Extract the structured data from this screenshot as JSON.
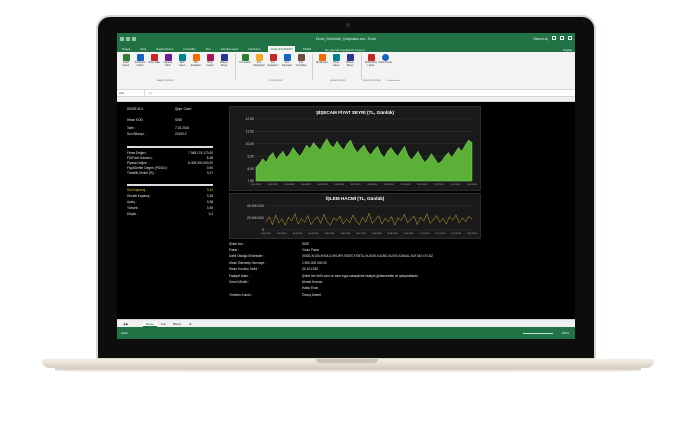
{
  "excel": {
    "title": "Ekran_Görüntüsü_Çalışmaları.xlsx - Excel",
    "user": "Oturum aç",
    "share": "Paylaş",
    "tabs": [
      "Dosya",
      "Giriş",
      "Sayfa Düzeni",
      "Formüller",
      "Veri",
      "Gözden Geçir",
      "Görünüm",
      "ANALİZ EXPERT",
      "TEAM"
    ],
    "active_tab": "ANALİZ EXPERT",
    "tell_me": "Ne yapmak istediğinizi söyleyin",
    "ribbon_buttons": [
      "Analiz Expert",
      "Portföyüm Analizi",
      "Hisse Tablo",
      "Kapanış Tablo",
      "Tarih Listesi",
      "Bul Endeksler",
      "Öztel Listeler",
      "Bilanço Rasyo",
      "Fon Listesi",
      "Fon Kategorileri",
      "Fon Endeksleri",
      "Fon Karşılaştır",
      "Fon Yöneticileri",
      "Bul Endeks",
      "Hisse Listesi",
      "Bilanço Rasyo",
      "Dahili Bizim Linkler",
      "Yardımcımda"
    ],
    "ribbon_groups": [
      "ANALİZ EXPERT",
      "FON EXPERT",
      "HİSSE EXPERT",
      "TAVSİYE EXPERT",
      "Yardımcımda"
    ],
    "name_box": "H16",
    "sheet_tabs": [
      "Hisse",
      "Fon",
      "Bilanç"
    ],
    "active_sheet": "Hisse",
    "status": "Hazır",
    "zoom": "100%"
  },
  "stock": {
    "header_label": "HİSSE ADI:",
    "header_value": "Şişe Cam",
    "fields": [
      {
        "label": "Hisse KOD :",
        "value": "SISE"
      },
      {
        "label": "Tarih :",
        "value": "7.03.2016"
      },
      {
        "label": "Son Bilanço :",
        "value": "2015/12"
      }
    ],
    "metrics": [
      {
        "label": "Firma Değeri :",
        "value": "7.965.176.170,00"
      },
      {
        "label": "FD/Favö Kazancı :",
        "value": "8,38"
      },
      {
        "label": "Piyasa Değeri :",
        "value": "6.408.000.000,00"
      },
      {
        "label": "Fiyat/Defter Değeri (PD/DD) :",
        "value": "0,90"
      },
      {
        "label": "Tümelik Verimi (%) :",
        "value": "3,27"
      }
    ],
    "prices": [
      {
        "label": "Son Kapanış :",
        "value": "3,42"
      },
      {
        "label": "Önceki Kapanış :",
        "value": "3,38"
      },
      {
        "label": "Açılış :",
        "value": "3,38"
      },
      {
        "label": "Yüksek :",
        "value": "3,45"
      },
      {
        "label": "Düşük :",
        "value": "3,4"
      }
    ]
  },
  "info": {
    "rows": [
      {
        "label": "Şirket Adı :",
        "value": "SISE"
      },
      {
        "label": "Pazar :",
        "value": "Yıldız Pazar"
      },
      {
        "label": "Dahil Olduğu Endeksler :",
        "value": "XI030,XI100,XHOLD,XKURY,XSIST,XTMTU,XUO30,XUO50,XU100,XUMAL,XUTUM,XYLDZ"
      },
      {
        "label": "Hisse Ödenmiş Sermaye :",
        "value": "1.900.000.000,00"
      },
      {
        "label": "Hisse Kuruluş Tarihi :",
        "value": "24.10.1935"
      },
      {
        "label": "Faaliyet Alanı :",
        "value": "Şirket her türlü cam ve cam eşya sanayiinde faaliyet göstermekte ve çalışmaktadır."
      },
      {
        "label": "Genel Müdür :",
        "value": "Ahmet Kırman"
      },
      {
        "label": "",
        "value": "Hakkı Ersin"
      },
      {
        "label": "Yönetim Kurulu :",
        "value": "Özsoy Ahmet"
      }
    ]
  },
  "chart_data": [
    {
      "type": "area",
      "title": "ŞİŞECAM FİYAT SEYRİ (TL, Günlük)",
      "ylim": [
        7.5,
        12.5
      ],
      "yticks": [
        "12,50",
        "11,50",
        "10,50",
        "9,50",
        "8,50",
        "7,50"
      ],
      "xticks": [
        "9.01.2015",
        "9.02.2015",
        "9.03.2015",
        "9.04.2015",
        "9.05.2015",
        "9.06.2015",
        "9.07.2015",
        "9.08.2015",
        "9.09.2015",
        "9.10.2015",
        "9.11.2015",
        "9.12.2015",
        "9.01.2016",
        "9.02.2016"
      ],
      "color": "#5fb83a",
      "values": [
        8.6,
        8.9,
        9.3,
        9.0,
        9.5,
        9.8,
        9.2,
        9.6,
        9.9,
        9.4,
        9.7,
        10.2,
        9.8,
        9.5,
        9.9,
        10.4,
        10.1,
        10.6,
        10.3,
        10.0,
        10.5,
        10.9,
        10.4,
        10.2,
        10.7,
        10.3,
        10.0,
        10.5,
        10.8,
        10.2,
        9.8,
        10.1,
        10.4,
        9.9,
        9.6,
        10.0,
        10.3,
        9.7,
        9.4,
        9.9,
        10.2,
        9.8,
        9.5,
        9.9,
        10.3,
        9.6,
        9.2,
        9.5,
        9.9,
        9.4,
        9.0,
        9.3,
        9.7,
        9.3,
        8.9,
        9.1,
        9.5,
        9.8,
        9.4,
        9.8,
        10.2,
        9.9,
        10.4,
        10.8,
        10.6
      ]
    },
    {
      "type": "line",
      "title": "İŞLEM HACMİ (TL, Günlük)",
      "ylim": [
        0,
        40000000
      ],
      "yticks": [
        "40.000.000",
        "20.000.000",
        "0"
      ],
      "xticks": [
        "9.01.2015",
        "9.02.2015",
        "9.03.2015",
        "9.04.2015",
        "9.05.2015",
        "9.06.2015",
        "9.07.2015",
        "9.08.2015",
        "9.09.2015",
        "9.10.2015",
        "9.11.2015",
        "9.12.2015",
        "9.01.2016",
        "9.02.2016"
      ],
      "color": "#c9a227",
      "values": [
        14000000,
        22000000,
        9000000,
        25000000,
        12000000,
        18000000,
        8000000,
        21000000,
        15000000,
        27000000,
        10000000,
        19000000,
        13000000,
        24000000,
        9000000,
        17000000,
        22000000,
        11000000,
        26000000,
        14000000,
        8000000,
        20000000,
        16000000,
        23000000,
        10000000,
        18000000,
        12000000,
        25000000,
        15000000,
        9000000,
        21000000,
        13000000,
        28000000,
        11000000,
        17000000,
        24000000,
        10000000,
        19000000,
        14000000,
        22000000,
        8000000,
        20000000,
        16000000,
        26000000,
        12000000,
        18000000,
        23000000,
        9000000,
        21000000,
        15000000,
        27000000,
        11000000,
        17000000,
        24000000,
        13000000,
        19000000,
        10000000,
        22000000,
        16000000,
        25000000,
        12000000,
        20000000,
        14000000,
        23000000,
        18000000
      ]
    }
  ]
}
